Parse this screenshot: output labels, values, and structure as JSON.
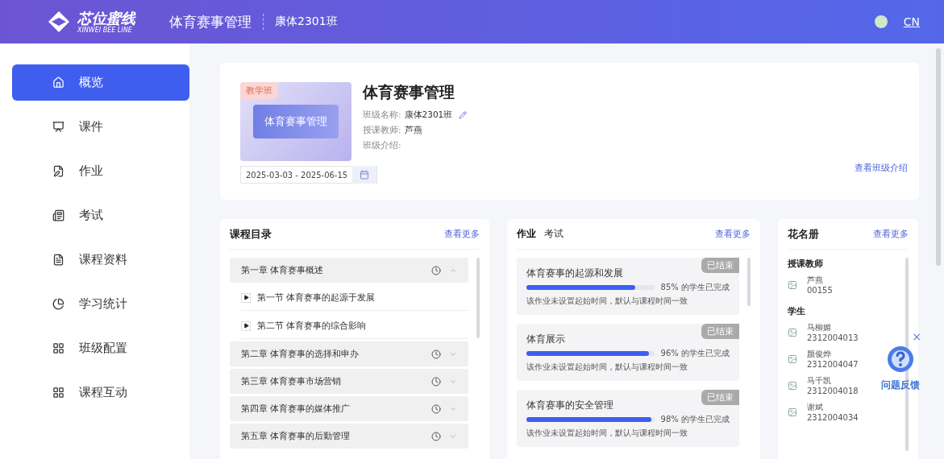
{
  "header": {
    "logo_text": "芯位蜜线",
    "logo_subtext": "XINWEI BEE LINE",
    "course_title": "体育赛事管理",
    "class_name": "康体2301班",
    "language": "CN"
  },
  "sidebar": {
    "items": [
      {
        "label": "概览",
        "selected": true
      },
      {
        "label": "课件",
        "selected": false
      },
      {
        "label": "作业",
        "selected": false
      },
      {
        "label": "考试",
        "selected": false
      },
      {
        "label": "课程资料",
        "selected": false
      },
      {
        "label": "学习统计",
        "selected": false
      },
      {
        "label": "班级配置",
        "selected": false
      },
      {
        "label": "课程互动",
        "selected": false
      }
    ]
  },
  "course_card": {
    "badge": "教学班",
    "cover_title": "体育赛事管理",
    "title": "体育赛事管理",
    "fields": [
      {
        "label": "班级名称:",
        "value": "康体2301班",
        "editable": true
      },
      {
        "label": "授课教师:",
        "value": "芦燕",
        "editable": false
      },
      {
        "label": "班级介绍:",
        "editable": false
      }
    ],
    "date_range": "2025-03-03 - 2025-06-15",
    "intro_link": "查看班级介绍"
  },
  "catalog": {
    "title": "课程目录",
    "more": "查看更多",
    "chapters": [
      {
        "label": "第一章 体育赛事概述",
        "expanded": true,
        "children": [
          {
            "label": "第一节 体育赛事的起源于发展"
          },
          {
            "label": "第二节 体育赛事的综合影响"
          }
        ]
      },
      {
        "label": "第二章 体育赛事的选择和申办",
        "expanded": false
      },
      {
        "label": "第三章 体育赛事市场营销",
        "expanded": false
      },
      {
        "label": "第四章 体育赛事的媒体推广",
        "expanded": false
      },
      {
        "label": "第五章 体育赛事的后勤管理",
        "expanded": false
      }
    ]
  },
  "tasks": {
    "tabs": [
      {
        "label": "作业",
        "selected": true
      },
      {
        "label": "考试",
        "selected": false
      }
    ],
    "more": "查看更多",
    "items": [
      {
        "title": "体育赛事的起源和发展",
        "status": "已结束",
        "level": 0.85,
        "completion": "85% 的学生已完成",
        "note": "该作业未设置起始时间，默认与课程时间一致"
      },
      {
        "title": "体育展示",
        "status": "已结束",
        "level": 0.96,
        "completion": "96% 的学生已完成",
        "note": "该作业未设置起始时间，默认与课程时间一致"
      },
      {
        "title": "体育赛事的安全管理",
        "status": "已结束",
        "level": 0.98,
        "completion": "98% 的学生已完成",
        "note": "该作业未设置起始时间，默认与课程时间一致"
      }
    ]
  },
  "roster": {
    "title": "花名册",
    "more": "查看更多",
    "groups": [
      {
        "heading": "授课教师",
        "people": [
          {
            "name": "芦燕",
            "id": "00155"
          }
        ]
      },
      {
        "heading": "学生",
        "people": [
          {
            "name": "马柳媚",
            "id": "2312004013"
          },
          {
            "name": "颜俊烨",
            "id": "2312004047"
          },
          {
            "name": "马千凯",
            "id": "2312004018"
          },
          {
            "name": "谢斌",
            "id": "2312004034"
          }
        ]
      }
    ]
  },
  "feedback": {
    "label": "问题反馈",
    "close": "×"
  }
}
